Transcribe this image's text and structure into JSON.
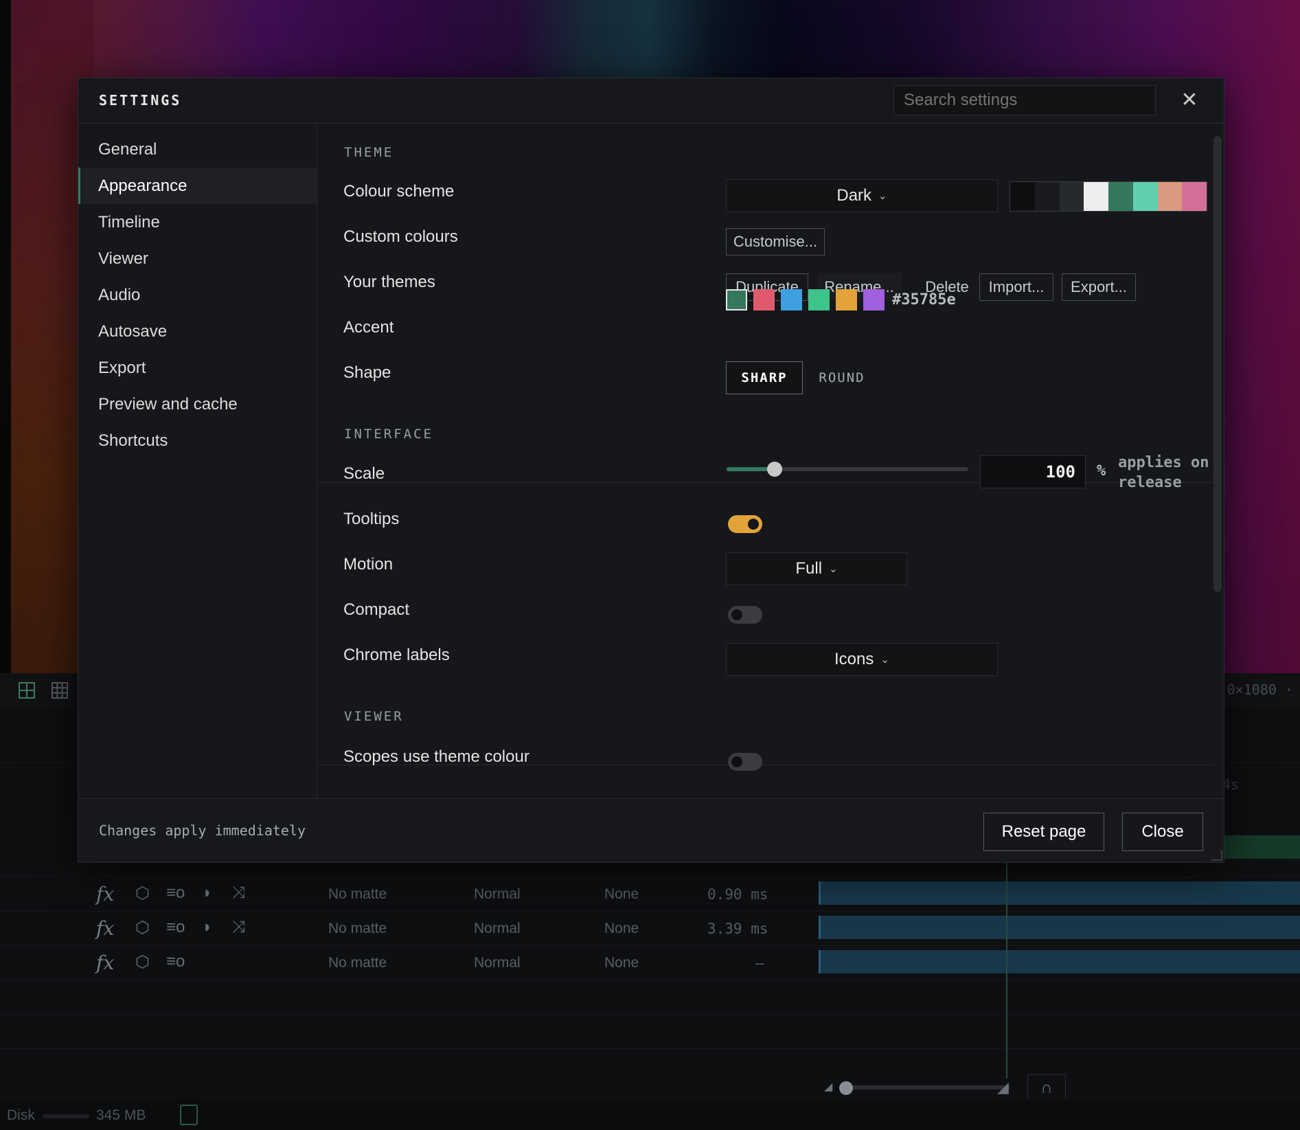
{
  "background": {
    "viewer_resolution": "0×1080 ·",
    "timeline_rows": [
      {
        "matte": "No matte",
        "blend": "Normal",
        "track": "None",
        "time": "0.90 ms"
      },
      {
        "matte": "No matte",
        "blend": "Normal",
        "track": "None",
        "time": "3.39 ms"
      },
      {
        "matte": "No matte",
        "blend": "Normal",
        "track": "None",
        "time": "–"
      }
    ],
    "fx_label": "fx",
    "ruler_label": "4s",
    "status": {
      "disk_label": "Disk",
      "disk_value": "345 MB"
    }
  },
  "modal": {
    "title": "SETTINGS",
    "search_placeholder": "Search settings",
    "close_glyph": "✕",
    "nav": [
      {
        "label": "General"
      },
      {
        "label": "Appearance",
        "active": true
      },
      {
        "label": "Timeline"
      },
      {
        "label": "Viewer"
      },
      {
        "label": "Audio"
      },
      {
        "label": "Autosave"
      },
      {
        "label": "Export"
      },
      {
        "label": "Preview and cache"
      },
      {
        "label": "Shortcuts"
      }
    ],
    "theme": {
      "section": "THEME",
      "colour_scheme_label": "Colour scheme",
      "colour_scheme_value": "Dark",
      "scheme_swatches": [
        "#0e0f11",
        "#1a1b1e",
        "#262a2c",
        "#eeeeee",
        "#35785e",
        "#5fcfae",
        "#d99a80",
        "#d46f9a"
      ],
      "custom_colours_label": "Custom colours",
      "customise_button": "Customise...",
      "your_themes_label": "Your themes",
      "theme_buttons": {
        "duplicate": "Duplicate",
        "rename": "Rename...",
        "delete": "Delete",
        "import": "Import...",
        "export": "Export..."
      },
      "accent_label": "Accent",
      "accent_swatches": [
        "#35785e",
        "#e05a6e",
        "#3ea0e0",
        "#3ec48a",
        "#e2a43a",
        "#a060e0"
      ],
      "accent_selected_index": 0,
      "accent_hex": "#35785e",
      "shape_label": "Shape",
      "shape_options": [
        "SHARP",
        "ROUND"
      ],
      "shape_selected": "SHARP"
    },
    "interface": {
      "section": "INTERFACE",
      "scale_label": "Scale",
      "scale_fraction": 0.2,
      "scale_value": "100",
      "scale_unit": "%",
      "scale_hint": "applies on release",
      "tooltips_label": "Tooltips",
      "tooltips_on": true,
      "motion_label": "Motion",
      "motion_value": "Full",
      "compact_label": "Compact",
      "compact_on": false,
      "chrome_labels_label": "Chrome labels",
      "chrome_labels_value": "Icons"
    },
    "viewer": {
      "section": "VIEWER",
      "scopes_label": "Scopes use theme colour",
      "scopes_on": false
    },
    "footer": {
      "note": "Changes apply immediately",
      "reset_button": "Reset page",
      "close_button": "Close"
    }
  }
}
